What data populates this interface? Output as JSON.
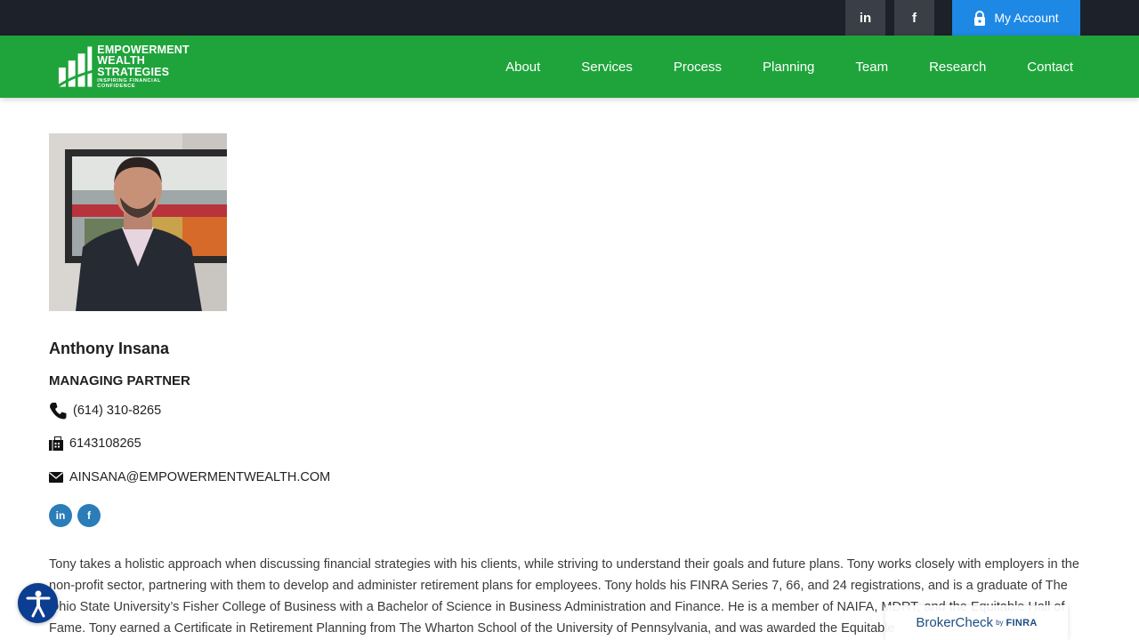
{
  "topbar": {
    "linkedin_label": "in",
    "facebook_label": "f",
    "account_label": "My Account"
  },
  "brand": {
    "line1": "EMPOWERMENT",
    "line2": "WEALTH",
    "line3": "STRATEGIES",
    "tagline": "INSPIRING FINANCIAL CONFIDENCE"
  },
  "nav": {
    "items": [
      "About",
      "Services",
      "Process",
      "Planning",
      "Team",
      "Research",
      "Contact"
    ]
  },
  "profile": {
    "name": "Anthony Insana",
    "title": "MANAGING PARTNER",
    "phone": "(614) 310-8265",
    "fax": "6143108265",
    "email": "AINSANA@EMPOWERMENTWEALTH.COM",
    "linkedin_label": "in",
    "facebook_label": "f",
    "bio": "Tony takes a holistic approach when discussing financial strategies with his clients, while striving to understand their goals and future plans. Tony works closely with employers in the non-profit sector, partnering with them to develop and administer retirement plans for employees. Tony holds his FINRA Series 7, 66, and 24 registrations, and is a graduate of The Ohio State University’s Fisher College of Business with a Bachelor of Science in Business Administration and Finance. He is a member of NAIFA, MDRT, and the Equitable Hall of Fame. Tony earned a Certificate in Retirement Planning from The Wharton School of the University of Pennsylvania, and was awarded the Equitable"
  },
  "brokercheck": {
    "main": "BrokerCheck",
    "by": "by",
    "finra": "FINRA"
  },
  "colors": {
    "topbar": "#1d2129",
    "nav_green": "#1fa43b",
    "account_blue": "#1e88e5",
    "social_blue": "#2a7db8",
    "accessibility_blue": "#0b3d91"
  },
  "icons": [
    "linkedin-icon",
    "facebook-icon",
    "lock-icon",
    "phone-icon",
    "fax-icon",
    "envelope-icon",
    "accessibility-icon"
  ]
}
